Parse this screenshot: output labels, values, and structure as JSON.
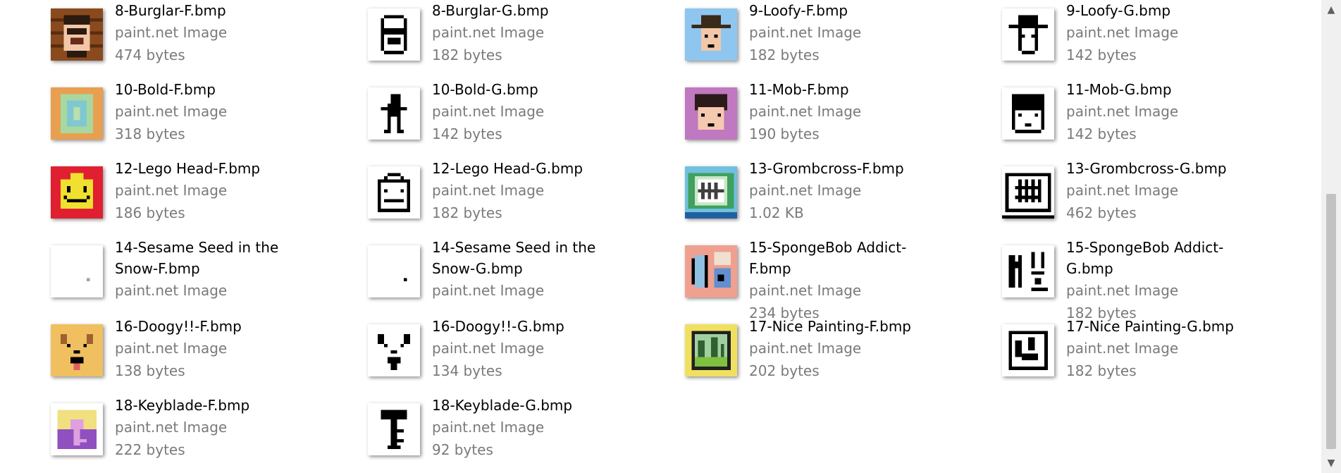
{
  "files": [
    {
      "name": "8-Burglar-F.bmp",
      "type": "paint.net Image",
      "size": "474 bytes",
      "icon": "burglar-thumbnail-icon"
    },
    {
      "name": "8-Burglar-G.bmp",
      "type": "paint.net Image",
      "size": "182 bytes",
      "icon": "burglar-mono-thumbnail-icon"
    },
    {
      "name": "9-Loofy-F.bmp",
      "type": "paint.net Image",
      "size": "182 bytes",
      "icon": "loofy-thumbnail-icon"
    },
    {
      "name": "9-Loofy-G.bmp",
      "type": "paint.net Image",
      "size": "142 bytes",
      "icon": "loofy-mono-thumbnail-icon"
    },
    {
      "name": "10-Bold-F.bmp",
      "type": "paint.net Image",
      "size": "318 bytes",
      "icon": "bold-thumbnail-icon"
    },
    {
      "name": "10-Bold-G.bmp",
      "type": "paint.net Image",
      "size": "142 bytes",
      "icon": "bold-mono-thumbnail-icon"
    },
    {
      "name": "11-Mob-F.bmp",
      "type": "paint.net Image",
      "size": "190 bytes",
      "icon": "mob-thumbnail-icon"
    },
    {
      "name": "11-Mob-G.bmp",
      "type": "paint.net Image",
      "size": "142 bytes",
      "icon": "mob-mono-thumbnail-icon"
    },
    {
      "name": "12-Lego Head-F.bmp",
      "type": "paint.net Image",
      "size": "186 bytes",
      "icon": "lego-head-thumbnail-icon"
    },
    {
      "name": "12-Lego Head-G.bmp",
      "type": "paint.net Image",
      "size": "182 bytes",
      "icon": "lego-head-mono-thumbnail-icon"
    },
    {
      "name": "13-Grombcross-F.bmp",
      "type": "paint.net Image",
      "size": "1.02 KB",
      "icon": "grombcross-thumbnail-icon"
    },
    {
      "name": "13-Grombcross-G.bmp",
      "type": "paint.net Image",
      "size": "462 bytes",
      "icon": "grombcross-mono-thumbnail-icon"
    },
    {
      "name": "14-Sesame Seed in the Snow-F.bmp",
      "type": "paint.net Image",
      "size": "",
      "icon": "sesame-seed-thumbnail-icon"
    },
    {
      "name": "14-Sesame Seed in the Snow-G.bmp",
      "type": "paint.net Image",
      "size": "",
      "icon": "sesame-seed-mono-thumbnail-icon"
    },
    {
      "name": "15-SpongeBob Addict-F.bmp",
      "type": "paint.net Image",
      "size": "234 bytes",
      "icon": "spongebob-addict-thumbnail-icon"
    },
    {
      "name": "15-SpongeBob Addict-G.bmp",
      "type": "paint.net Image",
      "size": "182 bytes",
      "icon": "spongebob-addict-mono-thumbnail-icon"
    },
    {
      "name": "16-Doogy!!-F.bmp",
      "type": "paint.net Image",
      "size": "138 bytes",
      "icon": "doogy-thumbnail-icon"
    },
    {
      "name": "16-Doogy!!-G.bmp",
      "type": "paint.net Image",
      "size": "134 bytes",
      "icon": "doogy-mono-thumbnail-icon"
    },
    {
      "name": "17-Nice Painting-F.bmp",
      "type": "paint.net Image",
      "size": "202 bytes",
      "icon": "painting-thumbnail-icon"
    },
    {
      "name": "17-Nice Painting-G.bmp",
      "type": "paint.net Image",
      "size": "182 bytes",
      "icon": "painting-mono-thumbnail-icon"
    },
    {
      "name": "18-Keyblade-F.bmp",
      "type": "paint.net Image",
      "size": "222 bytes",
      "icon": "keyblade-thumbnail-icon"
    },
    {
      "name": "18-Keyblade-G.bmp",
      "type": "paint.net Image",
      "size": "92 bytes",
      "icon": "keyblade-mono-thumbnail-icon"
    }
  ],
  "scrollbar": {
    "up_arrow": "▲",
    "down_arrow": "▼"
  }
}
